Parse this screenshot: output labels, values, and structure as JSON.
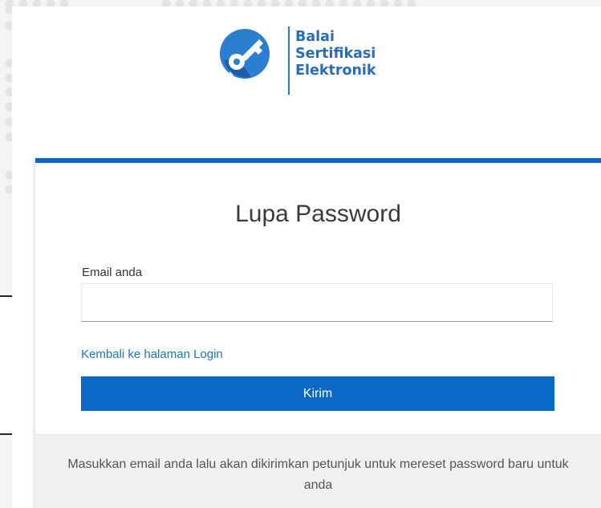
{
  "brand": {
    "logo_icon": "key-circle-icon",
    "name_line1": "Balai",
    "name_line2": "Sertifikasi",
    "name_line3": "Elektronik",
    "color": "#2a6cb5"
  },
  "form": {
    "title": "Lupa Password",
    "email_label": "Email anda",
    "email_value": "",
    "email_placeholder": "",
    "back_link": "Kembali ke halaman Login",
    "submit_label": "Kirim",
    "accent_color": "#0c68c6"
  },
  "info": {
    "text": "Masukkan email anda lalu akan dikirimkan petunjuk untuk mereset password baru untuk anda"
  }
}
